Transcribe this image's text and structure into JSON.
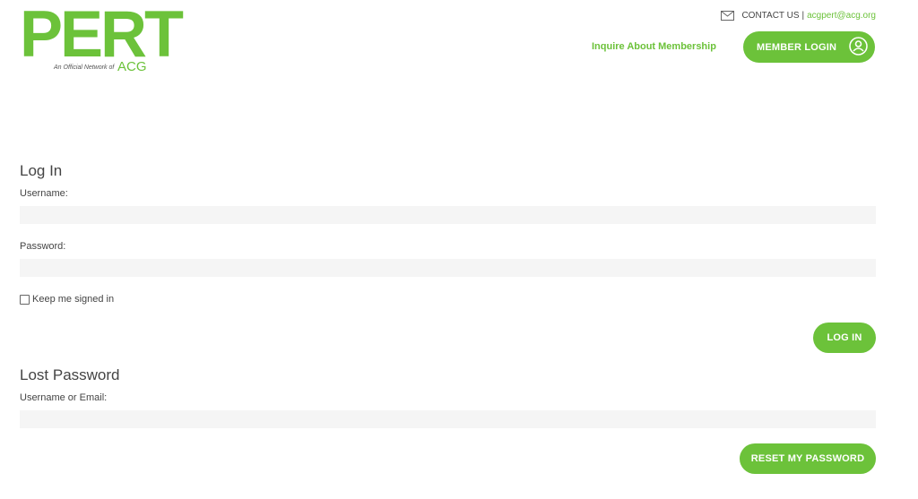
{
  "brand": {
    "logo_text": "PERT",
    "tagline": "An Official Network of",
    "partner": "ACG"
  },
  "header": {
    "contact_label": "CONTACT US",
    "separator": "|",
    "contact_email": "acgpert@acg.org",
    "inquire_link": "Inquire About Membership",
    "member_login_label": "MEMBER LOGIN"
  },
  "login_form": {
    "title": "Log In",
    "username_label": "Username:",
    "username_value": "",
    "password_label": "Password:",
    "password_value": "",
    "remember_label": "Keep me signed in",
    "remember_checked": false,
    "submit_label": "LOG IN"
  },
  "lost_password_form": {
    "title": "Lost Password",
    "user_or_email_label": "Username or Email:",
    "user_or_email_value": "",
    "submit_label": "RESET MY PASSWORD"
  },
  "colors": {
    "accent": "#6cc23a",
    "input_bg": "#f5f5f5",
    "text": "#444444"
  },
  "icons": {
    "mail": "mail-icon",
    "user": "user-icon"
  }
}
